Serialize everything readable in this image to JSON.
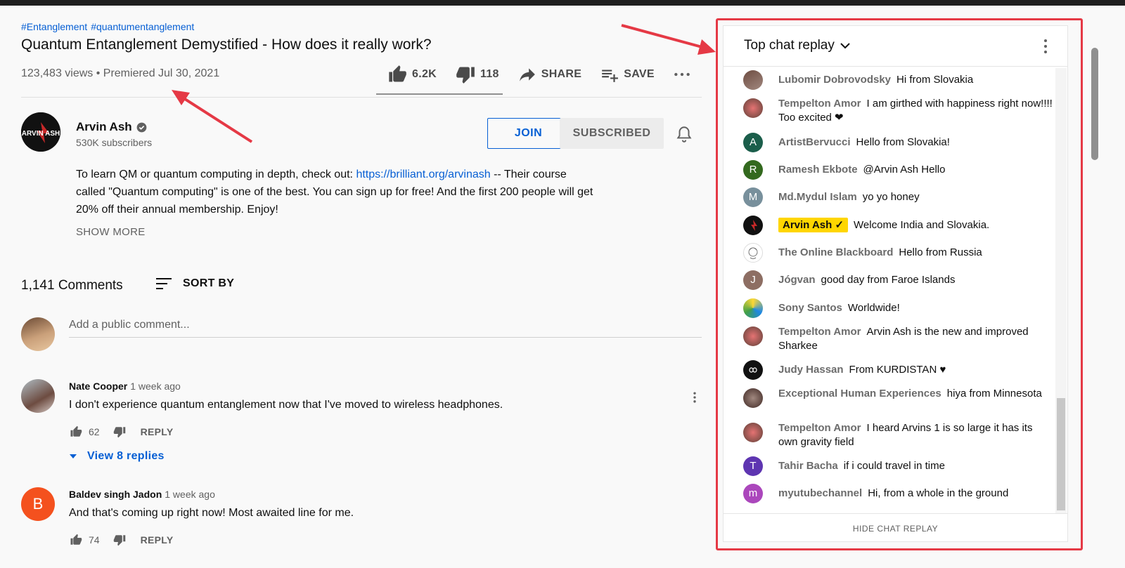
{
  "video": {
    "hashtags": [
      "#Entanglement",
      "#quantumentanglement"
    ],
    "title": "Quantum Entanglement Demystified - How does it really work?",
    "views": "123,483 views • Premiered Jul 30, 2021",
    "likes": "6.2K",
    "dislikes": "118",
    "share_label": "SHARE",
    "save_label": "SAVE"
  },
  "channel": {
    "name": "Arvin Ash",
    "subscribers": "530K subscribers",
    "join_label": "JOIN",
    "subscribed_label": "SUBSCRIBED",
    "avatar_text": "ARVIN ASH"
  },
  "description": {
    "text_before": "To learn QM or quantum computing in depth, check out:  ",
    "link": "https://brilliant.org/arvinash",
    "text_after": " -- Their course called \"Quantum computing\" is one of the best. You can sign up for free! And the first 200 people will get 20% off their annual membership. Enjoy!",
    "show_more": "SHOW MORE"
  },
  "comments": {
    "count_label": "1,141 Comments",
    "sort_label": "SORT BY",
    "placeholder": "Add a public comment...",
    "items": [
      {
        "author": "Nate Cooper",
        "time": "1 week ago",
        "text": "I don't experience quantum entanglement now that I've moved to wireless headphones.",
        "likes": "62",
        "reply_label": "REPLY",
        "replies_label": "View 8 replies"
      },
      {
        "author": "Baldev singh Jadon",
        "time": "1 week ago",
        "text": "And that's coming up right now! Most awaited line for me.",
        "likes": "74",
        "reply_label": "REPLY",
        "avatar_letter": "B",
        "avatar_color": "#f4511e"
      }
    ]
  },
  "chat": {
    "title": "Top chat replay",
    "hide_label": "HIDE CHAT REPLAY",
    "messages": [
      {
        "author": "Lubomir Dobrovodsky",
        "text": "Hi from Slovakia"
      },
      {
        "author": "Tempelton Amor",
        "text": "I am girthed with happiness right now!!!! Too excited ❤"
      },
      {
        "author": "ArtistBervucci",
        "text": "Hello from Slovakia!",
        "letter": "A",
        "color": "#1b5e4b"
      },
      {
        "author": "Ramesh Ekbote",
        "text": "@Arvin Ash Hello",
        "letter": "R",
        "color": "#33691e"
      },
      {
        "author": "Md.Mydul Islam",
        "text": "yo yo honey",
        "letter": "M",
        "color": "#78909c"
      },
      {
        "author": "Arvin Ash",
        "text": "Welcome India and Slovakia."
      },
      {
        "author": "The Online Blackboard",
        "text": "Hello from Russia"
      },
      {
        "author": "Jógvan",
        "text": "good day from Faroe Islands",
        "letter": "J",
        "color": "#8d6e63"
      },
      {
        "author": "Sony Santos",
        "text": "Worldwide!"
      },
      {
        "author": "Tempelton Amor",
        "text": "Arvin Ash is the new and improved Sharkee"
      },
      {
        "author": "Judy Hassan",
        "text": "From KURDISTAN ♥"
      },
      {
        "author": "Exceptional Human Experiences",
        "text": "hiya from Minnesota"
      },
      {
        "author": "Tempelton Amor",
        "text": "I heard Arvins 1 is so large it has its own gravity field"
      },
      {
        "author": "Tahir Bacha",
        "text": "if i could travel in time",
        "letter": "T",
        "color": "#5e35b1"
      },
      {
        "author": "myutubechannel",
        "text": "Hi, from a whole in the ground",
        "letter": "m",
        "color": "#ab47bc"
      }
    ]
  },
  "colors": {
    "link": "#065fd4",
    "annotation": "#e53945",
    "owner_badge": "#ffd600"
  }
}
